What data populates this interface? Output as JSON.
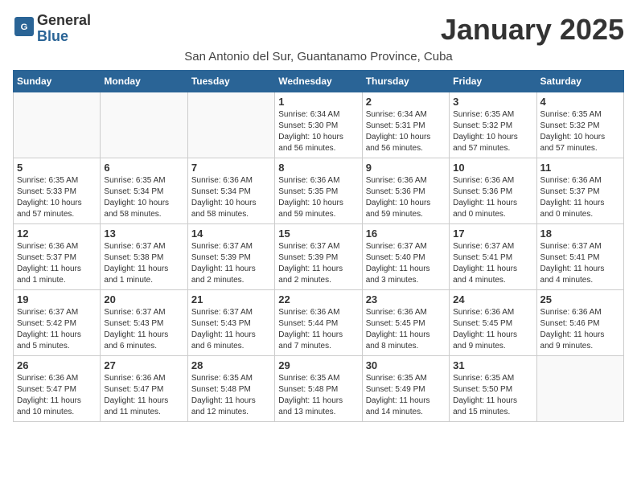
{
  "header": {
    "logo_general": "General",
    "logo_blue": "Blue",
    "month_title": "January 2025",
    "subtitle": "San Antonio del Sur, Guantanamo Province, Cuba"
  },
  "days_of_week": [
    "Sunday",
    "Monday",
    "Tuesday",
    "Wednesday",
    "Thursday",
    "Friday",
    "Saturday"
  ],
  "weeks": [
    [
      {
        "day": "",
        "info": ""
      },
      {
        "day": "",
        "info": ""
      },
      {
        "day": "",
        "info": ""
      },
      {
        "day": "1",
        "info": "Sunrise: 6:34 AM\nSunset: 5:30 PM\nDaylight: 10 hours\nand 56 minutes."
      },
      {
        "day": "2",
        "info": "Sunrise: 6:34 AM\nSunset: 5:31 PM\nDaylight: 10 hours\nand 56 minutes."
      },
      {
        "day": "3",
        "info": "Sunrise: 6:35 AM\nSunset: 5:32 PM\nDaylight: 10 hours\nand 57 minutes."
      },
      {
        "day": "4",
        "info": "Sunrise: 6:35 AM\nSunset: 5:32 PM\nDaylight: 10 hours\nand 57 minutes."
      }
    ],
    [
      {
        "day": "5",
        "info": "Sunrise: 6:35 AM\nSunset: 5:33 PM\nDaylight: 10 hours\nand 57 minutes."
      },
      {
        "day": "6",
        "info": "Sunrise: 6:35 AM\nSunset: 5:34 PM\nDaylight: 10 hours\nand 58 minutes."
      },
      {
        "day": "7",
        "info": "Sunrise: 6:36 AM\nSunset: 5:34 PM\nDaylight: 10 hours\nand 58 minutes."
      },
      {
        "day": "8",
        "info": "Sunrise: 6:36 AM\nSunset: 5:35 PM\nDaylight: 10 hours\nand 59 minutes."
      },
      {
        "day": "9",
        "info": "Sunrise: 6:36 AM\nSunset: 5:36 PM\nDaylight: 10 hours\nand 59 minutes."
      },
      {
        "day": "10",
        "info": "Sunrise: 6:36 AM\nSunset: 5:36 PM\nDaylight: 11 hours\nand 0 minutes."
      },
      {
        "day": "11",
        "info": "Sunrise: 6:36 AM\nSunset: 5:37 PM\nDaylight: 11 hours\nand 0 minutes."
      }
    ],
    [
      {
        "day": "12",
        "info": "Sunrise: 6:36 AM\nSunset: 5:37 PM\nDaylight: 11 hours\nand 1 minute."
      },
      {
        "day": "13",
        "info": "Sunrise: 6:37 AM\nSunset: 5:38 PM\nDaylight: 11 hours\nand 1 minute."
      },
      {
        "day": "14",
        "info": "Sunrise: 6:37 AM\nSunset: 5:39 PM\nDaylight: 11 hours\nand 2 minutes."
      },
      {
        "day": "15",
        "info": "Sunrise: 6:37 AM\nSunset: 5:39 PM\nDaylight: 11 hours\nand 2 minutes."
      },
      {
        "day": "16",
        "info": "Sunrise: 6:37 AM\nSunset: 5:40 PM\nDaylight: 11 hours\nand 3 minutes."
      },
      {
        "day": "17",
        "info": "Sunrise: 6:37 AM\nSunset: 5:41 PM\nDaylight: 11 hours\nand 4 minutes."
      },
      {
        "day": "18",
        "info": "Sunrise: 6:37 AM\nSunset: 5:41 PM\nDaylight: 11 hours\nand 4 minutes."
      }
    ],
    [
      {
        "day": "19",
        "info": "Sunrise: 6:37 AM\nSunset: 5:42 PM\nDaylight: 11 hours\nand 5 minutes."
      },
      {
        "day": "20",
        "info": "Sunrise: 6:37 AM\nSunset: 5:43 PM\nDaylight: 11 hours\nand 6 minutes."
      },
      {
        "day": "21",
        "info": "Sunrise: 6:37 AM\nSunset: 5:43 PM\nDaylight: 11 hours\nand 6 minutes."
      },
      {
        "day": "22",
        "info": "Sunrise: 6:36 AM\nSunset: 5:44 PM\nDaylight: 11 hours\nand 7 minutes."
      },
      {
        "day": "23",
        "info": "Sunrise: 6:36 AM\nSunset: 5:45 PM\nDaylight: 11 hours\nand 8 minutes."
      },
      {
        "day": "24",
        "info": "Sunrise: 6:36 AM\nSunset: 5:45 PM\nDaylight: 11 hours\nand 9 minutes."
      },
      {
        "day": "25",
        "info": "Sunrise: 6:36 AM\nSunset: 5:46 PM\nDaylight: 11 hours\nand 9 minutes."
      }
    ],
    [
      {
        "day": "26",
        "info": "Sunrise: 6:36 AM\nSunset: 5:47 PM\nDaylight: 11 hours\nand 10 minutes."
      },
      {
        "day": "27",
        "info": "Sunrise: 6:36 AM\nSunset: 5:47 PM\nDaylight: 11 hours\nand 11 minutes."
      },
      {
        "day": "28",
        "info": "Sunrise: 6:35 AM\nSunset: 5:48 PM\nDaylight: 11 hours\nand 12 minutes."
      },
      {
        "day": "29",
        "info": "Sunrise: 6:35 AM\nSunset: 5:48 PM\nDaylight: 11 hours\nand 13 minutes."
      },
      {
        "day": "30",
        "info": "Sunrise: 6:35 AM\nSunset: 5:49 PM\nDaylight: 11 hours\nand 14 minutes."
      },
      {
        "day": "31",
        "info": "Sunrise: 6:35 AM\nSunset: 5:50 PM\nDaylight: 11 hours\nand 15 minutes."
      },
      {
        "day": "",
        "info": ""
      }
    ]
  ]
}
